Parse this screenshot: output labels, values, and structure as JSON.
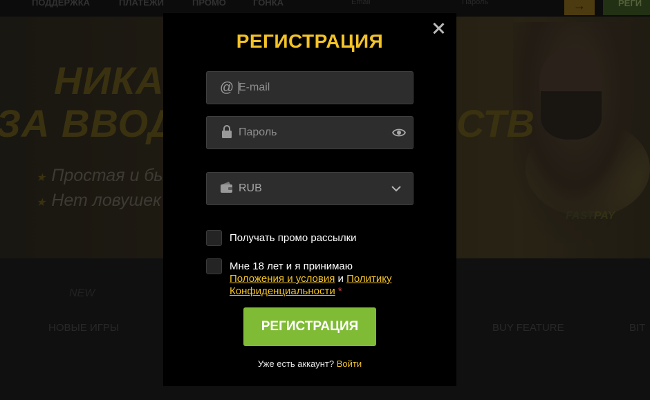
{
  "background": {
    "nav": [
      "ПОДДЕРЖКА",
      "ПЛАТЕЖИ",
      "ПРОМО",
      "ГОНКА"
    ],
    "search_placeholder": "Email",
    "lang": "Пароль",
    "register_label": "РЕГИ",
    "hero": {
      "title_line1": "НИКА",
      "title_line2_left": "ЗА ВВОД",
      "title_line2_right": "СТВ",
      "bullets": [
        "Простая и бы",
        "Нет ловушек"
      ]
    },
    "logo_text": "FAST",
    "logo_text2": "PAY",
    "categories": {
      "new_icon": "NEW",
      "new_label": "НОВЫЕ ИГРЫ",
      "buy_label": "BUY FEATURE",
      "bit_label": "BIT"
    }
  },
  "modal": {
    "title": "РЕГИСТРАЦИЯ",
    "email": {
      "icon": "at-icon",
      "placeholder": "E-mail"
    },
    "password": {
      "icon": "lock-icon",
      "placeholder": "Пароль"
    },
    "currency": {
      "icon": "wallet-icon",
      "value": "RUB"
    },
    "promo_label": "Получать промо рассылки",
    "terms": {
      "prefix": "Мне 18 лет и я принимаю",
      "link1": "Положения и условия",
      "and": "и",
      "link2": "Политику Конфиденциальности",
      "required_mark": "*"
    },
    "submit_label": "РЕГИСТРАЦИЯ",
    "have_account": "Уже есть аккаунт?",
    "login_link": "Войти"
  },
  "colors": {
    "accent_yellow": "#f2c227",
    "button_green": "#7fbb35",
    "required_red": "#e03a3a"
  }
}
